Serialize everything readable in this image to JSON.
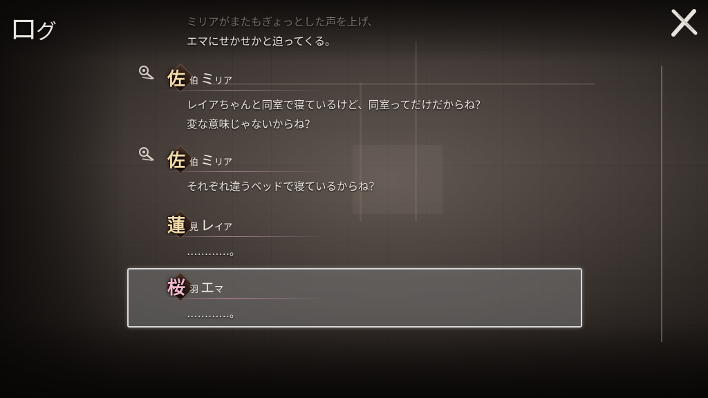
{
  "header": {
    "title_main": "ロ",
    "title_small": "グ"
  },
  "close_label": "close",
  "log": {
    "narration": [
      "ミリアがまたもぎょっとした声を上げ、",
      "エマにせかせかと迫ってくる。"
    ],
    "entries": [
      {
        "surname_kanji": "佐",
        "surname_sub": "伯",
        "given_big": "ミ",
        "given_small": "リア",
        "has_voice": true,
        "lines": [
          "レイアちゃんと同室で寝ているけど、同室ってだけだからね？",
          "変な意味じゃないからね？"
        ]
      },
      {
        "surname_kanji": "佐",
        "surname_sub": "伯",
        "given_big": "ミ",
        "given_small": "リア",
        "has_voice": true,
        "lines": [
          "それぞれ違うベッドで寝ているからね？"
        ]
      },
      {
        "surname_kanji": "蓮",
        "surname_sub": "見",
        "given_big": "レ",
        "given_small": "イア",
        "has_voice": false,
        "lines": [
          "…………。"
        ]
      },
      {
        "surname_kanji": "桜",
        "surname_sub": "羽",
        "given_big": "エ",
        "given_small": "マ",
        "has_voice": false,
        "selected": true,
        "lines": [
          "…………。"
        ]
      }
    ]
  }
}
